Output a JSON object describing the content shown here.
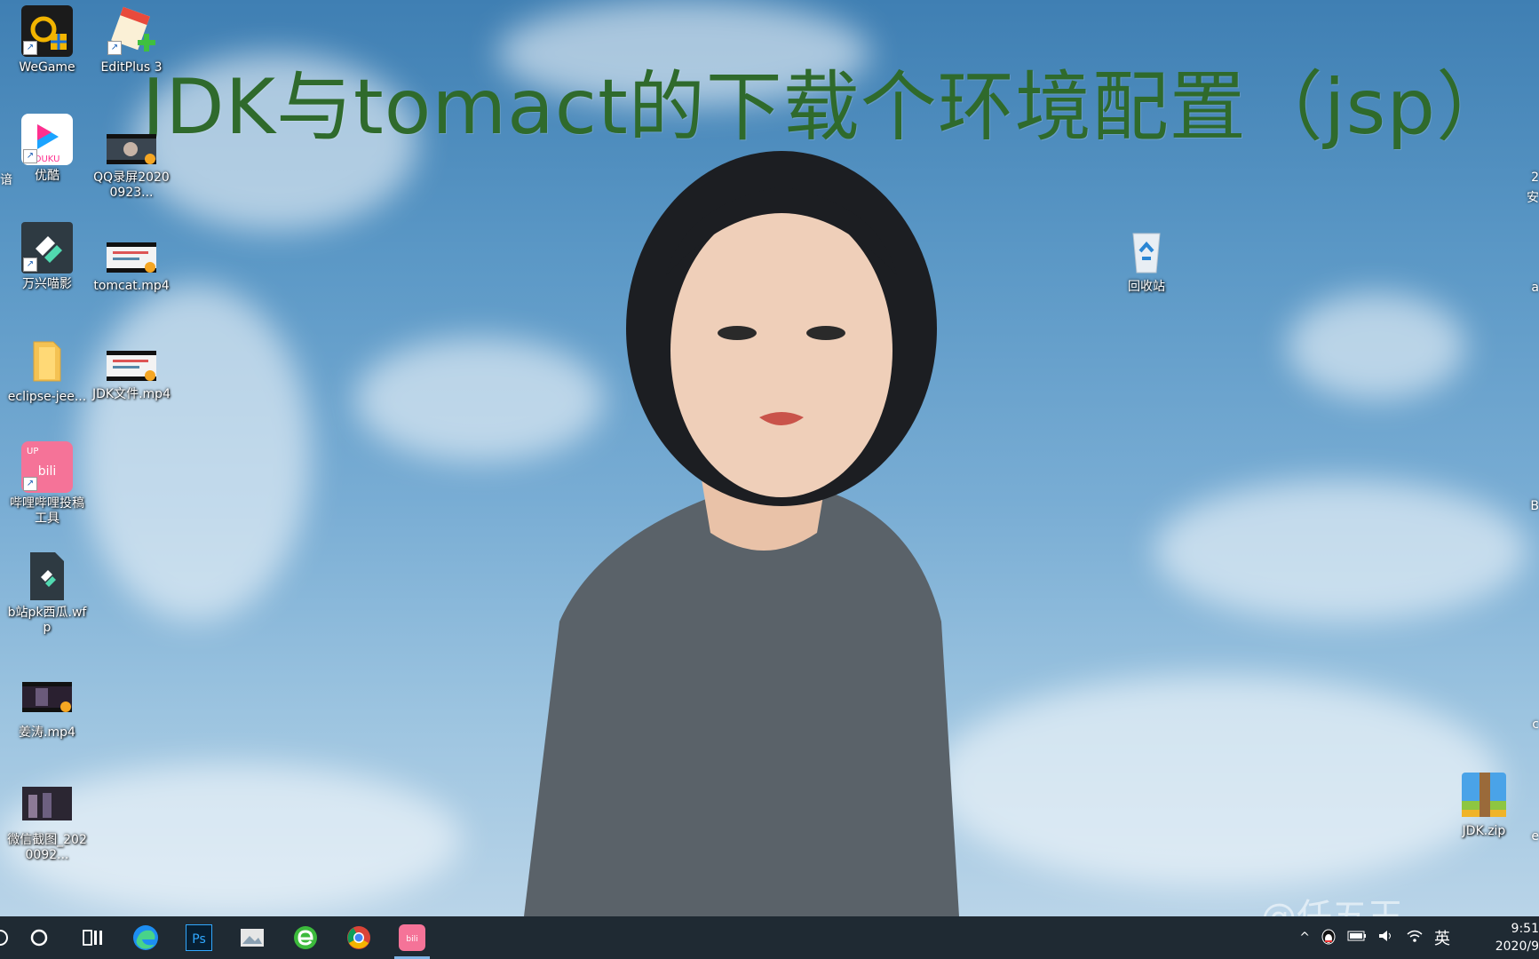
{
  "overlay": {
    "title": "JDK与tomact的下载个环境配置（jsp）"
  },
  "desktop": {
    "icons": [
      {
        "label": "WeGame"
      },
      {
        "label": "EditPlus 3"
      },
      {
        "label": "优酷"
      },
      {
        "label": "QQ录屏20200923..."
      },
      {
        "label": "万兴喵影"
      },
      {
        "label": "tomcat.mp4"
      },
      {
        "label": "eclipse-jee..."
      },
      {
        "label": "JDK文件.mp4"
      },
      {
        "label": "哔哩哔哩投稿工具"
      },
      {
        "label": "b站pk西瓜.wfp"
      },
      {
        "label": "姜涛.mp4"
      },
      {
        "label": "微信截图_2020092..."
      },
      {
        "label": "回收站"
      },
      {
        "label": "JDK.zip"
      }
    ],
    "right_edge_fragments": [
      "2",
      "安",
      "a",
      "B",
      "c",
      "e"
    ],
    "left_edge_fragments": [
      "谙"
    ]
  },
  "taskbar": {
    "ime_label": "英",
    "clock_time": "9:51",
    "clock_date": "2020/9"
  },
  "watermark": "@任五王",
  "colors": {
    "title_green": "#2f6a2c",
    "taskbar_bg": "#1f2a33"
  }
}
